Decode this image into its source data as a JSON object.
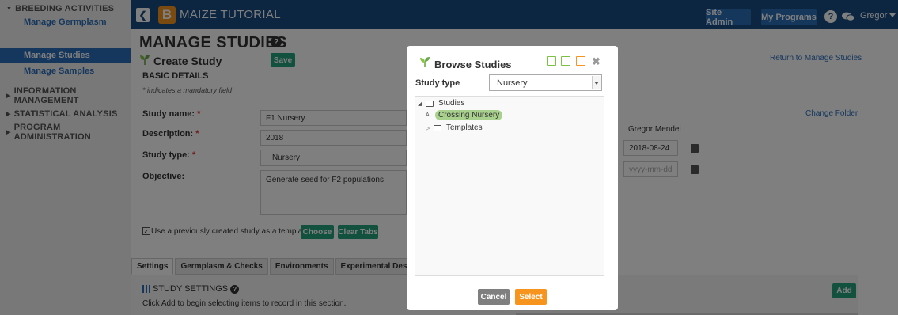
{
  "sidebar": {
    "categories": [
      {
        "label": "BREEDING ACTIVITIES",
        "items": [
          {
            "label": "Manage Germplasm"
          },
          {
            "label": "Manage Studies"
          },
          {
            "label": "Manage Samples"
          }
        ]
      },
      {
        "label": "INFORMATION MANAGEMENT"
      },
      {
        "label": "STATISTICAL ANALYSIS"
      },
      {
        "label": "PROGRAM ADMINISTRATION"
      }
    ]
  },
  "topbar": {
    "logo_letter": "B",
    "title": "MAIZE TUTORIAL",
    "site_admin": "Site Admin",
    "my_programs": "My Programs",
    "help_glyph": "?",
    "user": "Gregor"
  },
  "page": {
    "title": "MANAGE STUDIES",
    "help_glyph": "?",
    "create_study": "Create Study",
    "save_label": "Save",
    "basic_details": "BASIC DETAILS",
    "mandatory_note": "* indicates a mandatory field",
    "return_link": "Return to Manage Studies",
    "change_folder": "Change Folder",
    "owner": "Gregor Mendel",
    "fields": {
      "study_name": {
        "label": "Study name",
        "req": "*",
        "value": "F1 Nursery"
      },
      "description": {
        "label": "Description",
        "req": "*",
        "value": "2018"
      },
      "study_type": {
        "label": "Study type",
        "req": "*",
        "value": "Nursery"
      },
      "objective": {
        "label": "Objective",
        "value": "Generate seed for F2 populations"
      },
      "start_date": {
        "value": "2018-08-24"
      },
      "end_date": {
        "placeholder": "yyyy-mm-dd"
      }
    },
    "template": {
      "checkbox_glyph": "✓",
      "label": "Use a previously created study as a template",
      "choose": "Choose",
      "clear_tabs": "Clear Tabs"
    },
    "tabs": [
      "Settings",
      "Germplasm & Checks",
      "Environments",
      "Experimental Design"
    ],
    "settings": {
      "title": "STUDY SETTINGS",
      "help_glyph": "?",
      "hint": "Click Add to begin selecting items to record in this section.",
      "add": "Add"
    }
  },
  "modal": {
    "title": "Browse Studies",
    "close_glyph": "✖",
    "study_type_label": "Study type",
    "study_type_value": "Nursery",
    "tree": {
      "root": "Studies",
      "selected": "Crossing Nursery",
      "templates": "Templates",
      "expand_glyph": "◢",
      "collapsed_glyph": "▷",
      "leaf_glyph": "A"
    },
    "cancel": "Cancel",
    "select": "Select"
  },
  "colors": {
    "topbar": "#184d85",
    "accent_blue": "#2a6ebb",
    "teal": "#27a27e",
    "orange": "#f7941d",
    "selected_node": "#a9d18e"
  }
}
